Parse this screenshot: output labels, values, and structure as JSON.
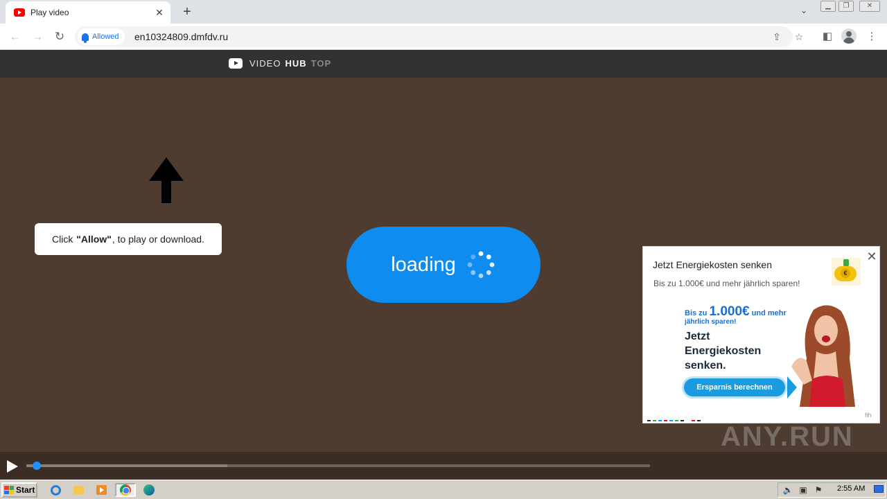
{
  "browser": {
    "tab_title": "Play video",
    "tab_close": "✕",
    "new_tab": "+",
    "permission_chip": "Allowed",
    "url": "en10324809.dmfdv.ru"
  },
  "site": {
    "logo_video": "VIDEO",
    "logo_hub": "HUB",
    "logo_top": "TOP",
    "allow_prefix": "Click",
    "allow_bold": "\"Allow\"",
    "allow_suffix": ", to play or download.",
    "loading": "loading",
    "progress_fraction": 0.01
  },
  "ad": {
    "title": "Jetzt Energiekosten senken",
    "subtitle": "Bis zu 1.000€ und mehr jährlich sparen!",
    "banner_bis_zu": "Bis zu",
    "banner_amount": "1.000€",
    "banner_und_mehr": "und mehr",
    "banner_line2": "jährlich sparen!",
    "banner_headline_1": "Jetzt",
    "banner_headline_2": "Energiekosten",
    "banner_headline_3": "senken.",
    "cta": "Ersparnis berechnen",
    "footnote": "fih",
    "close": "✕"
  },
  "watermark": "ANY.RUN",
  "taskbar": {
    "start": "Start",
    "clock": "2:55 AM"
  },
  "colors": {
    "page_bg": "#4e3c30",
    "loading_pill": "#0e8cf0",
    "header_bg": "#333131",
    "accent_blue": "#1a73e8"
  }
}
